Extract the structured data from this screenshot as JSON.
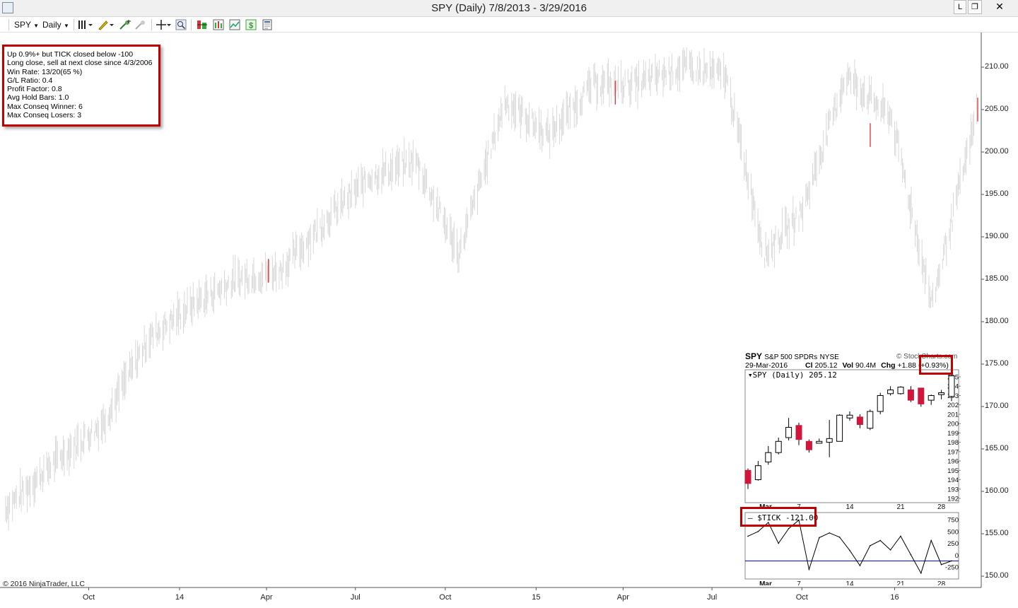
{
  "window": {
    "title": "SPY (Daily)  7/8/2013 - 3/29/2016",
    "controls": [
      "L",
      "❐",
      "✕"
    ]
  },
  "toolbar": {
    "symbol": "SPY",
    "interval": "Daily"
  },
  "stats_box": {
    "lines": [
      "Up 0.9%+ but TICK closed below -100",
      "Long close, sell at next close since 4/3/2006",
      "Win Rate: 13/20(65 %)",
      "G/L Ratio: 0.4",
      "Profit Factor: 0.8",
      "Avg Hold Bars: 1.0",
      "Max Conseq Winner: 6",
      "Max Conseq Losers: 3"
    ]
  },
  "copyright": "© 2016 NinjaTrader, LLC",
  "main_chart": {
    "y_axis_labels": [
      "210.00",
      "205.00",
      "200.00",
      "195.00",
      "190.00",
      "185.00",
      "180.00",
      "175.00",
      "170.00",
      "165.00",
      "160.00",
      "155.00",
      "150.00"
    ],
    "x_axis_labels": [
      "Oct",
      "14",
      "Apr",
      "Jul",
      "Oct",
      "15",
      "Apr",
      "Jul",
      "Oct",
      "16"
    ]
  },
  "inset": {
    "symbol": "SPY",
    "name": "S&P 500 SPDRs",
    "exchange": "NYSE",
    "source": "© StockCharts.com",
    "date": "29-Mar-2016",
    "cl_label": "Cl",
    "cl": "205.12",
    "vol_label": "Vol",
    "vol": "90.4M",
    "chg_label": "Chg",
    "chg": "+1.88",
    "chg_pct": "(+0.93%)",
    "price_legend": "SPY (Daily) 205.12",
    "price_y_labels": [
      "205",
      "204",
      "203",
      "202",
      "201",
      "200",
      "199",
      "198",
      "197",
      "196",
      "195",
      "194",
      "193",
      "192"
    ],
    "x_labels": [
      "Mar",
      "7",
      "14",
      "21",
      "28"
    ],
    "tick_legend": "$TICK -121.00",
    "tick_y_labels": [
      "750",
      "500",
      "250",
      "0",
      "-250"
    ]
  },
  "colors": {
    "accent_red": "#c00000",
    "down_candle": "#d0163a",
    "trade_marker": "#e02020",
    "tick_line": "#000080"
  },
  "chart_data": [
    {
      "type": "line",
      "title": "SPY (Daily)  7/8/2013 - 3/29/2016",
      "xlabel": "",
      "ylabel": "",
      "ylim": [
        148,
        212
      ],
      "x": [
        "2013-07-08",
        "2013-09-01",
        "2013-10-15",
        "2013-12-01",
        "2014-01-15",
        "2014-03-01",
        "2014-04-15",
        "2014-06-01",
        "2014-07-15",
        "2014-09-01",
        "2014-10-15",
        "2014-12-01",
        "2015-01-15",
        "2015-03-01",
        "2015-04-15",
        "2015-06-01",
        "2015-07-15",
        "2015-08-24",
        "2015-10-01",
        "2015-11-15",
        "2016-01-01",
        "2016-02-11",
        "2016-03-29"
      ],
      "series": [
        {
          "values": [
            158,
            164,
            168,
            178,
            182,
            185,
            186,
            192,
            197,
            199,
            188,
            206,
            202,
            208,
            208,
            210,
            209,
            188,
            193,
            209,
            204,
            182,
            205
          ]
        }
      ],
      "trade_markers": [
        {
          "x": "2014-04-03",
          "close": 186
        },
        {
          "x": "2015-03-24",
          "close": 207
        },
        {
          "x": "2015-12-10",
          "close": 202
        },
        {
          "x": "2016-03-29",
          "close": 205
        }
      ]
    },
    {
      "type": "candlestick",
      "title": "SPY (Daily) 205.12",
      "ylim": [
        191.5,
        205.5
      ],
      "categories": [
        "Feb 29",
        "Mar 1",
        "Mar 2",
        "Mar 3",
        "Mar 4",
        "Mar 7",
        "Mar 8",
        "Mar 9",
        "Mar 10",
        "Mar 11",
        "Mar 14",
        "Mar 15",
        "Mar 16",
        "Mar 17",
        "Mar 18",
        "Mar 21",
        "Mar 22",
        "Mar 23",
        "Mar 24",
        "Mar 28",
        "Mar 29"
      ],
      "open": [
        195.0,
        194.0,
        195.9,
        196.9,
        198.5,
        199.8,
        198.1,
        197.9,
        198.0,
        198.1,
        200.6,
        200.7,
        199.5,
        201.3,
        203.2,
        203.2,
        203.6,
        203.8,
        202.5,
        203.1,
        202.9
      ],
      "close": [
        193.6,
        195.5,
        196.9,
        198.1,
        199.6,
        198.3,
        197.2,
        198.1,
        198.4,
        200.9,
        200.9,
        199.9,
        201.3,
        203.0,
        203.6,
        203.9,
        202.5,
        202.1,
        203.0,
        203.3,
        205.1
      ],
      "high": [
        195.2,
        196.0,
        197.6,
        198.5,
        200.6,
        200.1,
        198.3,
        198.4,
        200.4,
        201.0,
        201.3,
        201.0,
        201.5,
        203.3,
        204.0,
        204.0,
        204.0,
        203.8,
        203.1,
        203.6,
        205.3
      ],
      "low": [
        193.0,
        193.9,
        195.6,
        196.7,
        198.2,
        197.7,
        196.9,
        197.9,
        196.4,
        199.6,
        200.3,
        199.5,
        199.3,
        201.0,
        203.0,
        203.1,
        202.3,
        201.8,
        202.0,
        202.6,
        202.4
      ]
    },
    {
      "type": "line",
      "title": "$TICK -121.00",
      "ylim": [
        -400,
        850
      ],
      "categories": [
        "Feb 29",
        "Mar 1",
        "Mar 2",
        "Mar 3",
        "Mar 4",
        "Mar 7",
        "Mar 8",
        "Mar 9",
        "Mar 10",
        "Mar 11",
        "Mar 14",
        "Mar 15",
        "Mar 16",
        "Mar 17",
        "Mar 18",
        "Mar 21",
        "Mar 22",
        "Mar 23",
        "Mar 24",
        "Mar 28",
        "Mar 29"
      ],
      "series": [
        {
          "name": "$TICK",
          "values": [
            400,
            500,
            690,
            250,
            560,
            740,
            -300,
            370,
            470,
            380,
            100,
            -220,
            200,
            310,
            110,
            400,
            10,
            -380,
            310,
            -200,
            -121
          ]
        }
      ],
      "reference_line": -121
    }
  ]
}
